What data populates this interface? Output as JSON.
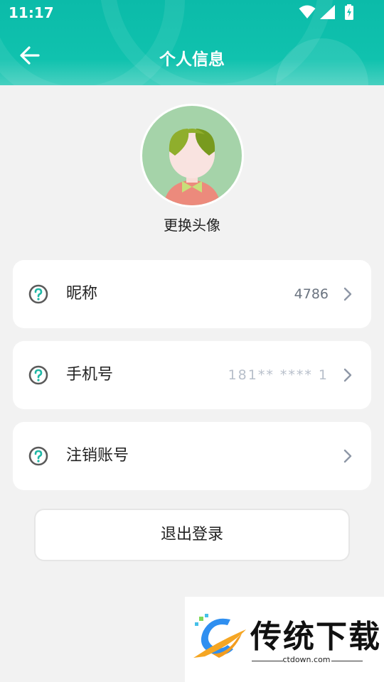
{
  "status_bar": {
    "time": "11:17",
    "icons": [
      "wifi-icon",
      "signal-icon",
      "battery-charging-icon"
    ]
  },
  "header": {
    "title": "个人信息",
    "back_icon": "arrow-left-icon",
    "background_color": "#10c2ae"
  },
  "avatar": {
    "change_label": "更换头像"
  },
  "rows": [
    {
      "label": "昵称",
      "value": "4786",
      "icon": "question-circle-icon"
    },
    {
      "label": "手机号",
      "value": "181** **** 1",
      "icon": "question-circle-icon"
    },
    {
      "label": "注销账号",
      "value": "",
      "icon": "question-circle-icon"
    }
  ],
  "logout": {
    "label": "退出登录"
  },
  "watermark": {
    "brand": "传统下载",
    "url": "ctdown.com"
  },
  "colors": {
    "accent": "#10c2ae",
    "page_background": "#f2f2f2",
    "icon_teal": "#1fb8a6",
    "icon_gray": "#5a5a5a",
    "chevron": "#8e97a6"
  }
}
